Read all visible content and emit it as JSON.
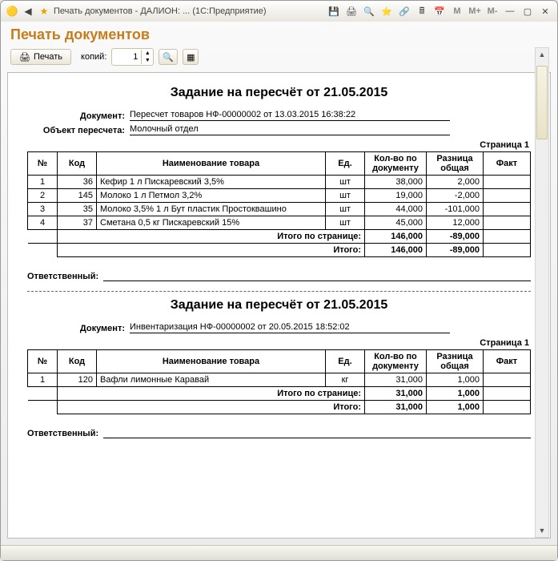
{
  "titlebar": {
    "text": "Печать документов - ДАЛИОН: ...   (1С:Предприятие)"
  },
  "page": {
    "title": "Печать документов",
    "print_btn": "Печать",
    "copies_label": "копий:",
    "copies_value": "1"
  },
  "reports": [
    {
      "title": "Задание на пересчёт от 21.05.2015",
      "doc_label": "Документ:",
      "doc_value": "Пересчет товаров НФ-00000002 от 13.03.2015 16:38:22",
      "obj_label": "Объект пересчета:",
      "obj_value": "Молочный отдел",
      "page_label": "Страница 1",
      "headers": [
        "№",
        "Код",
        "Наименование товара",
        "Ед.",
        "Кол-во по документу",
        "Разница общая",
        "Факт"
      ],
      "rows": [
        {
          "n": "1",
          "code": "36",
          "name": "Кефир 1 л  Пискаревский 3,5%",
          "unit": "шт",
          "qty": "38,000",
          "diff": "2,000",
          "fact": ""
        },
        {
          "n": "2",
          "code": "145",
          "name": "Молоко 1 л   Петмол 3,2%",
          "unit": "шт",
          "qty": "19,000",
          "diff": "-2,000",
          "fact": ""
        },
        {
          "n": "3",
          "code": "35",
          "name": "Молоко 3,5% 1 л Бут пластик Простоквашино",
          "unit": "шт",
          "qty": "44,000",
          "diff": "-101,000",
          "fact": ""
        },
        {
          "n": "4",
          "code": "37",
          "name": "Сметана 0,5 кг  Пискаревский 15%",
          "unit": "шт",
          "qty": "45,000",
          "diff": "12,000",
          "fact": ""
        }
      ],
      "page_total_label": "Итого по странице:",
      "page_total_qty": "146,000",
      "page_total_diff": "-89,000",
      "total_label": "Итого:",
      "total_qty": "146,000",
      "total_diff": "-89,000",
      "resp_label": "Ответственный:"
    },
    {
      "title": "Задание на пересчёт от 21.05.2015",
      "doc_label": "Документ:",
      "doc_value": "Инвентаризация НФ-00000002 от 20.05.2015 18:52:02",
      "page_label": "Страница 1",
      "headers": [
        "№",
        "Код",
        "Наименование товара",
        "Ед.",
        "Кол-во по документу",
        "Разница общая",
        "Факт"
      ],
      "rows": [
        {
          "n": "1",
          "code": "120",
          "name": "Вафли лимонные Каравай",
          "unit": "кг",
          "qty": "31,000",
          "diff": "1,000",
          "fact": ""
        }
      ],
      "page_total_label": "Итого по странице:",
      "page_total_qty": "31,000",
      "page_total_diff": "1,000",
      "total_label": "Итого:",
      "total_qty": "31,000",
      "total_diff": "1,000",
      "resp_label": "Ответственный:"
    }
  ]
}
